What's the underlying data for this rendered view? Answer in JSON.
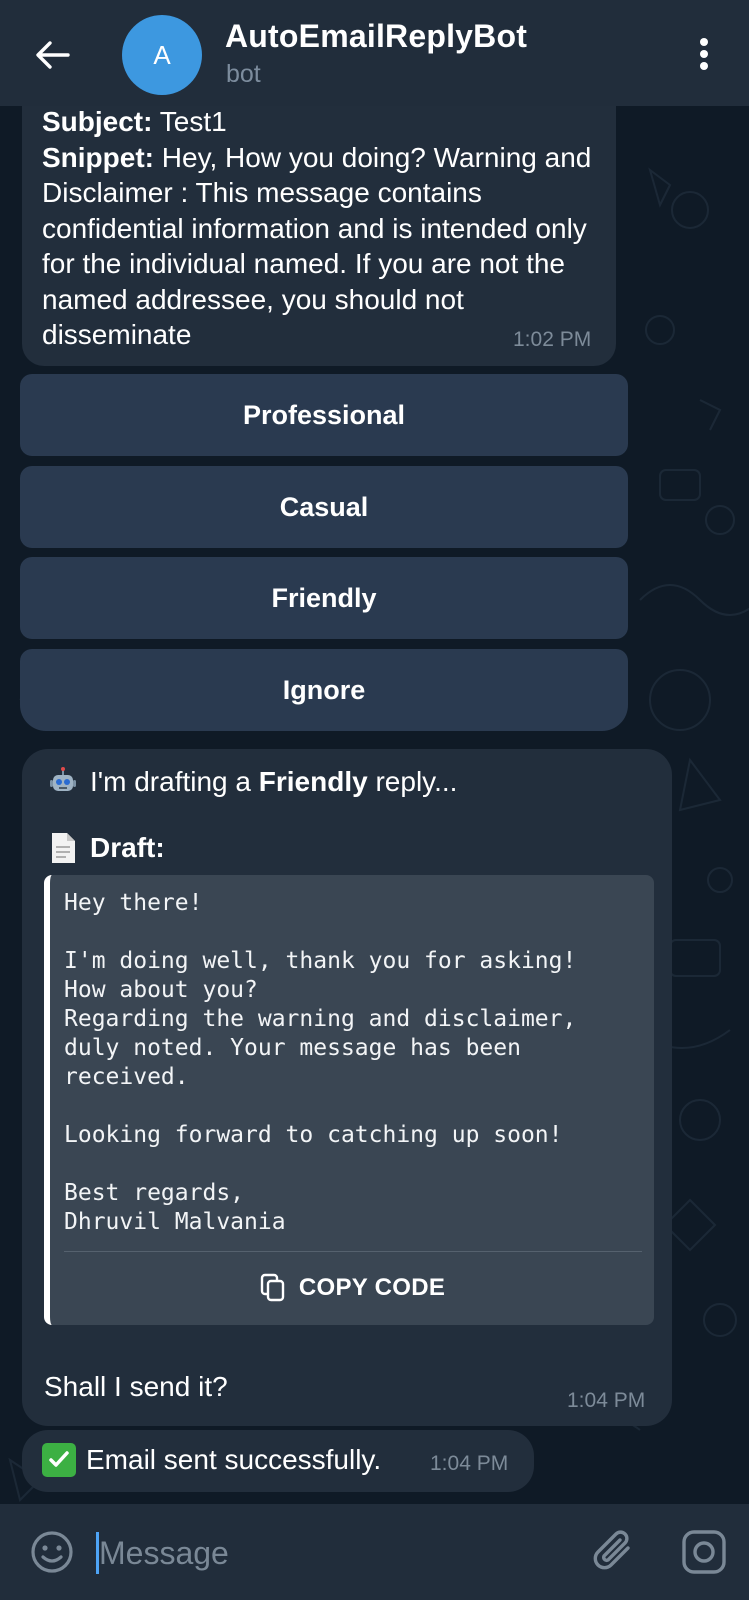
{
  "header": {
    "avatar_letter": "A",
    "title": "AutoEmailReplyBot",
    "subtitle": "bot"
  },
  "email_message": {
    "subject_label": "Subject:",
    "subject_value": "Test1",
    "snippet_label": "Snippet:",
    "snippet_value": "Hey, How you doing? Warning and Disclaimer : This message contains confidential information and is intended only for the individual named. If you are not the named addressee, you should not disseminate",
    "time": "1:02 PM"
  },
  "reply_options": [
    "Professional",
    "Casual",
    "Friendly",
    "Ignore"
  ],
  "draft_message": {
    "drafting_prefix": "I'm drafting a",
    "drafting_tone": "Friendly",
    "drafting_suffix": "reply...",
    "draft_label": "Draft:",
    "draft_body": "Hey there!\n\nI'm doing well, thank you for asking!\nHow about you?\nRegarding the warning and disclaimer,\nduly noted. Your message has been\nreceived.\n\nLooking forward to catching up soon!\n\nBest regards,\nDhruvil Malvania",
    "copy_label": "COPY CODE",
    "question": "Shall I send it?",
    "time": "1:04 PM"
  },
  "sent_message": {
    "text": "Email sent successfully.",
    "time": "1:04 PM"
  },
  "input": {
    "placeholder": "Message"
  },
  "icons": {
    "back": "arrow-left-icon",
    "menu": "more-vertical-icon",
    "robot": "robot-emoji-icon",
    "document": "document-emoji-icon",
    "check": "check-mark-emoji-icon",
    "copy": "copy-icon",
    "emoji": "smiley-icon",
    "attach": "paperclip-icon",
    "camera": "camera-icon"
  },
  "colors": {
    "header_bg": "#212d3b",
    "bubble_bg": "#222e3c",
    "button_bg": "#2a3a50",
    "avatar_bg": "#3d98e0",
    "code_bg": "#3a4653",
    "check_green": "#3cb043",
    "accent": "#4ea4f6"
  }
}
